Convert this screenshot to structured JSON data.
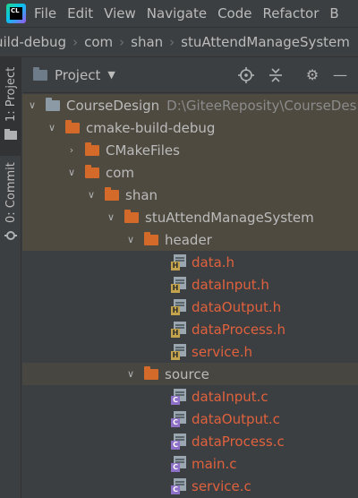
{
  "menu": {
    "items": [
      "File",
      "Edit",
      "View",
      "Navigate",
      "Code",
      "Refactor",
      "B"
    ]
  },
  "breadcrumb": [
    "uild-debug",
    "com",
    "shan",
    "stuAttendManageSystem"
  ],
  "toolstrip": {
    "project_tab": "1: Project",
    "commit_tab": "0: Commit"
  },
  "tool_window": {
    "title": "Project"
  },
  "tree": {
    "root": {
      "name": "CourseDesign",
      "path": "D:\\GiteeReposity\\CourseDes"
    },
    "cmake_build_debug": "cmake-build-debug",
    "cmakefiles": "CMakeFiles",
    "com": "com",
    "shan": "shan",
    "stu": "stuAttendManageSystem",
    "header": "header",
    "header_files": [
      "data.h",
      "dataInput.h",
      "dataOutput.h",
      "dataProcess.h",
      "service.h"
    ],
    "source": "source",
    "source_files": [
      "dataInput.c",
      "dataOutput.c",
      "dataProcess.c",
      "main.c",
      "service.c"
    ]
  },
  "colors": {
    "background": "#3c3f41",
    "text": "#bbbbbb",
    "excluded_text": "#e0613d",
    "folder": "#d36a2a",
    "selected_row": "#4e4a40"
  }
}
